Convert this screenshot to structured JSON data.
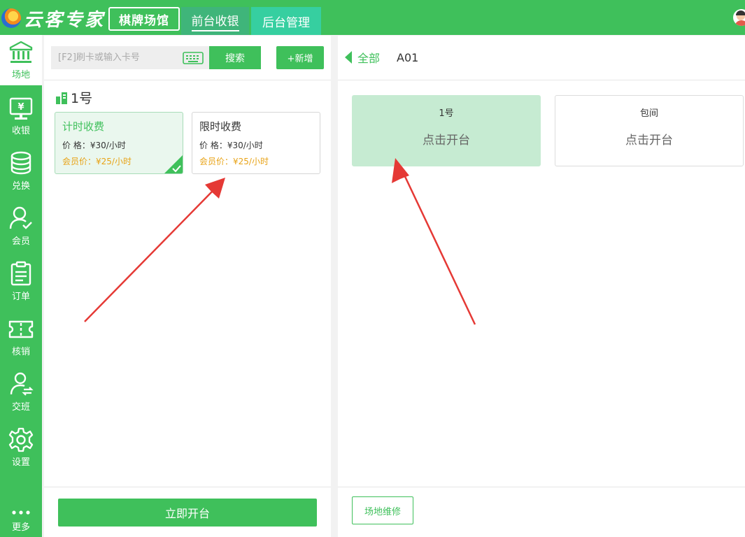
{
  "header": {
    "logo_text": "云客专家",
    "venue_badge": "棋牌场馆",
    "tabs": [
      {
        "label": "前台收银",
        "active": true
      },
      {
        "label": "后台管理",
        "active": false
      }
    ]
  },
  "sidebar": {
    "items": [
      {
        "label": "场地",
        "icon": "venue-icon",
        "active": true
      },
      {
        "label": "收银",
        "icon": "cashier-icon"
      },
      {
        "label": "兑换",
        "icon": "coins-icon"
      },
      {
        "label": "会员",
        "icon": "member-icon"
      },
      {
        "label": "订单",
        "icon": "order-icon"
      },
      {
        "label": "核销",
        "icon": "ticket-icon"
      },
      {
        "label": "交班",
        "icon": "handover-icon"
      },
      {
        "label": "设置",
        "icon": "gear-icon"
      },
      {
        "label": "更多",
        "icon": "more-icon"
      }
    ]
  },
  "left": {
    "search": {
      "placeholder": "[F2]刷卡或输入卡号",
      "button": "搜索"
    },
    "add_button": "+新增",
    "group_title": "1号",
    "fee_cards": [
      {
        "name": "计时收费",
        "price": "价 格：¥30/小时",
        "member_price": "会员价：¥25/小时",
        "selected": true
      },
      {
        "name": "限时收费",
        "price": "价 格：¥30/小时",
        "member_price": "会员价：¥25/小时",
        "selected": false
      }
    ],
    "open_button": "立即开台"
  },
  "right": {
    "breadcrumb": {
      "all": "全部",
      "current": "A01"
    },
    "tables": [
      {
        "name": "1号",
        "status": "点击开台",
        "highlighted": true
      },
      {
        "name": "包间",
        "status": "点击开台",
        "highlighted": false
      }
    ],
    "repair_button": "场地维修"
  },
  "colors": {
    "brand_green": "#3fc05b",
    "annotation_red": "#e53935",
    "member_price_orange": "#e8a317"
  }
}
